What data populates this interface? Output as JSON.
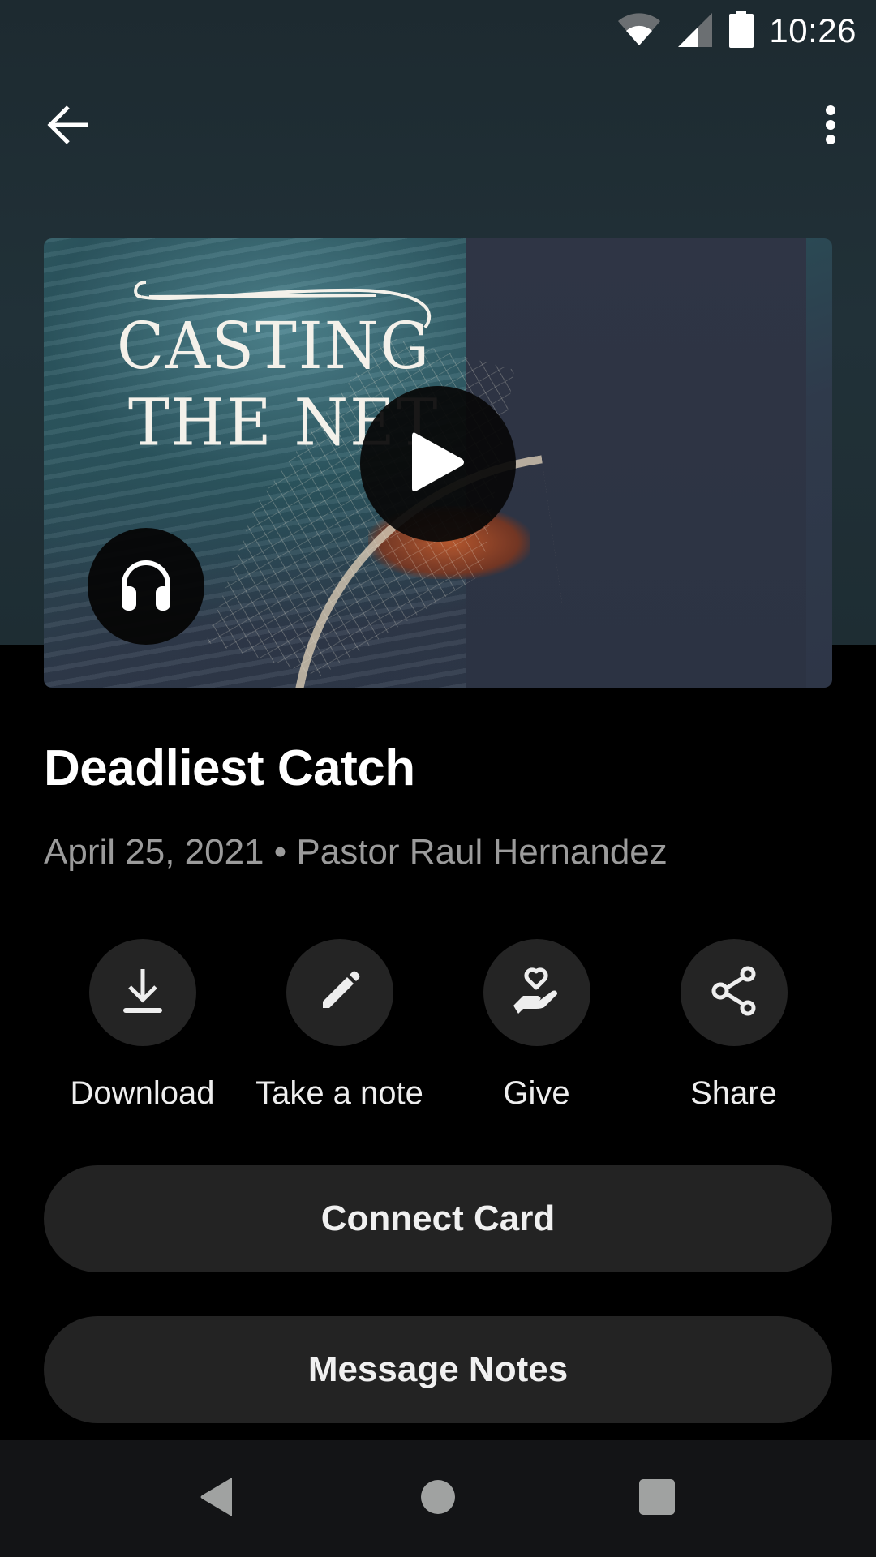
{
  "status_bar": {
    "time": "10:26",
    "icons": [
      "wifi-icon",
      "cellular-signal-icon",
      "battery-icon"
    ]
  },
  "toolbar": {
    "back_icon": "arrow-back-icon",
    "more_icon": "more-vertical-icon"
  },
  "artwork": {
    "title_line1": "CASTING",
    "title_line2": "THE NET",
    "play_icon": "play-icon",
    "audio_icon": "headphones-icon"
  },
  "sermon": {
    "title": "Deadliest Catch",
    "date": "April 25, 2021",
    "separator": "•",
    "speaker": "Pastor Raul Hernandez"
  },
  "actions": [
    {
      "label": "Download",
      "icon": "download-icon"
    },
    {
      "label": "Take a note",
      "icon": "pencil-icon"
    },
    {
      "label": "Give",
      "icon": "hand-heart-icon"
    },
    {
      "label": "Share",
      "icon": "share-icon"
    }
  ],
  "buttons": {
    "connect_card": "Connect Card",
    "message_notes": "Message Notes"
  },
  "nav_bar": {
    "items": [
      "back-triangle-icon",
      "home-circle-icon",
      "recents-square-icon"
    ]
  },
  "colors": {
    "background": "#000000",
    "hero_background": "#213138",
    "button_background": "#232323",
    "meta_text": "#9b9b9b",
    "nav_bar": "#131416"
  }
}
